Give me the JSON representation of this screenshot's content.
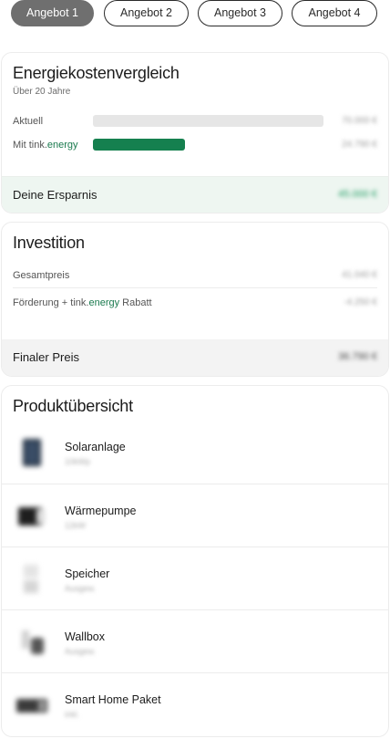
{
  "tabs": [
    {
      "label": "Angebot 1",
      "active": true
    },
    {
      "label": "Angebot 2",
      "active": false
    },
    {
      "label": "Angebot 3",
      "active": false
    },
    {
      "label": "Angebot 4",
      "active": false
    }
  ],
  "energy_card": {
    "title": "Energiekostenvergleich",
    "subtitle": "Über 20 Jahre",
    "rows": [
      {
        "label": "Aktuell",
        "value": "70.000 €",
        "bar_fraction": 1.0
      },
      {
        "label_prefix": "Mit tink.",
        "label_accent": "energy",
        "value": "24.790 €",
        "bar_fraction": 0.4
      }
    ],
    "savings_label": "Deine Ersparnis",
    "savings_value": "45.000 €"
  },
  "investment_card": {
    "title": "Investition",
    "rows": [
      {
        "label": "Gesamtpreis",
        "value": "41.040 €"
      },
      {
        "label_prefix": "Förderung + tink.",
        "label_accent": "energy",
        "label_suffix": " Rabatt",
        "value": "-4.250 €"
      }
    ],
    "final_label": "Finaler Preis",
    "final_value": "36.790 €"
  },
  "products_card": {
    "title": "Produktübersicht",
    "items": [
      {
        "name": "Solaranlage",
        "sub": "10kWp",
        "icon": "solar-panel-icon"
      },
      {
        "name": "Wärmepumpe",
        "sub": "12kW",
        "icon": "heat-pump-icon"
      },
      {
        "name": "Speicher",
        "sub": "Ausgew.",
        "icon": "battery-storage-icon"
      },
      {
        "name": "Wallbox",
        "sub": "Ausgew.",
        "icon": "wallbox-icon"
      },
      {
        "name": "Smart Home Paket",
        "sub": "inkl.",
        "icon": "smart-home-icon"
      }
    ]
  },
  "colors": {
    "accent_green": "#15804f",
    "active_tab": "#6f6f6f",
    "savings_bg": "#eef6f1"
  }
}
